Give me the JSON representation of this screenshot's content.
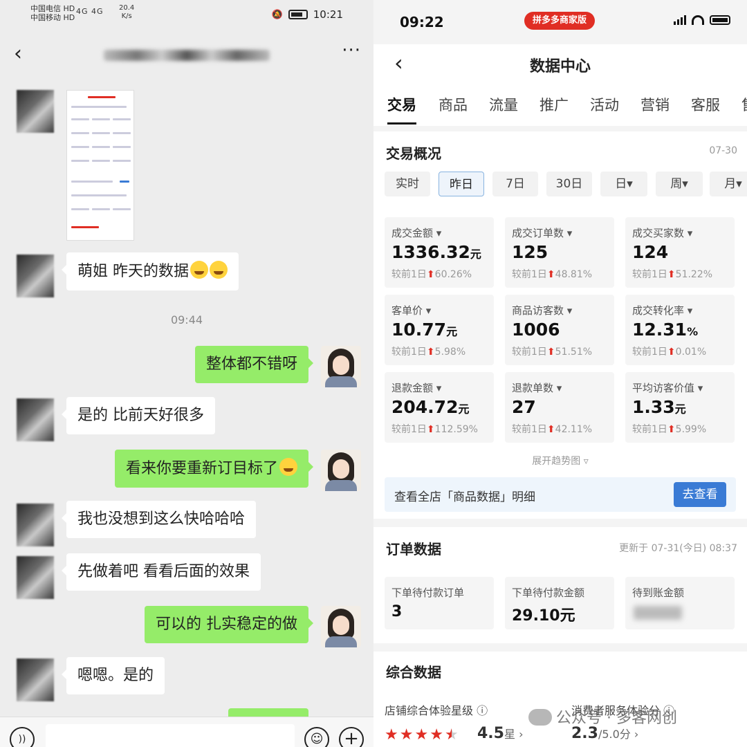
{
  "left": {
    "status": {
      "carrier1": "中国电信 HD",
      "carrier2": "中国移动 HD",
      "net": "4G 4G",
      "speed": "20.4",
      "speed_unit": "K/s",
      "time": "10:21"
    },
    "header": {
      "back_icon": "chevron-left-icon",
      "more_label": "···"
    },
    "timestamp": "09:44",
    "messages": [
      {
        "side": "in",
        "text": "萌姐 昨天的数据"
      },
      {
        "side": "out",
        "text": "整体都不错呀"
      },
      {
        "side": "in",
        "text": "是的 比前天好很多"
      },
      {
        "side": "out",
        "text": "看来你要重新订目标了"
      },
      {
        "side": "in",
        "text": "我也没想到这么快哈哈哈"
      },
      {
        "side": "in",
        "text": "先做着吧 看看后面的效果"
      },
      {
        "side": "out",
        "text": "可以的 扎实稳定的做"
      },
      {
        "side": "in",
        "text": "嗯嗯。是的"
      }
    ],
    "inputbar": {
      "voice": "))",
      "emoji": "☺",
      "plus": "+"
    }
  },
  "right": {
    "status": {
      "time": "09:22",
      "badge": "拼多多商家版"
    },
    "header": {
      "title": "数据中心",
      "back": "‹"
    },
    "tabs": [
      "交易",
      "商品",
      "流量",
      "推广",
      "活动",
      "营销",
      "客服",
      "售"
    ],
    "trade": {
      "title": "交易概况",
      "date": "07-30",
      "periods": [
        "实时",
        "昨日",
        "7日",
        "30日",
        "日▾",
        "周▾",
        "月▾"
      ],
      "metrics": [
        {
          "label": "成交金额 ▾",
          "value": "1336.32",
          "unit": "元",
          "cmp_prefix": "较前1日",
          "change": "60.26%"
        },
        {
          "label": "成交订单数 ▾",
          "value": "125",
          "unit": "",
          "cmp_prefix": "较前1日",
          "change": "48.81%"
        },
        {
          "label": "成交买家数 ▾",
          "value": "124",
          "unit": "",
          "cmp_prefix": "较前1日",
          "change": "51.22%"
        },
        {
          "label": "客单价 ▾",
          "value": "10.77",
          "unit": "元",
          "cmp_prefix": "较前1日",
          "change": "5.98%"
        },
        {
          "label": "商品访客数 ▾",
          "value": "1006",
          "unit": "",
          "cmp_prefix": "较前1日",
          "change": "51.51%"
        },
        {
          "label": "成交转化率 ▾",
          "value": "12.31",
          "unit": "%",
          "cmp_prefix": "较前1日",
          "change": "0.01%"
        },
        {
          "label": "退款金额 ▾",
          "value": "204.72",
          "unit": "元",
          "cmp_prefix": "较前1日",
          "change": "112.59%"
        },
        {
          "label": "退款单数 ▾",
          "value": "27",
          "unit": "",
          "cmp_prefix": "较前1日",
          "change": "42.11%"
        },
        {
          "label": "平均访客价值 ▾",
          "value": "1.33",
          "unit": "元",
          "cmp_prefix": "较前1日",
          "change": "5.99%"
        }
      ],
      "expand": "展开趋势图 ▿",
      "banner_text": "查看全店「商品数据」明细",
      "banner_btn": "去查看"
    },
    "orders": {
      "title": "订单数据",
      "updated": "更新于 07-31(今日) 08:37",
      "items": [
        {
          "label": "下单待付款订单",
          "value": "3"
        },
        {
          "label": "下单待付款金额",
          "value": "29.10元"
        },
        {
          "label": "待到账金额",
          "value": ""
        }
      ]
    },
    "overall": {
      "title": "综合数据",
      "exp_label": "店铺综合体验星级 ⓘ",
      "service_label": "消费者服务体验分 ⓘ",
      "stars": 4.5,
      "rating_value": "4.5",
      "rating_unit": "星 ›",
      "score_value": "2.3",
      "score_unit": "/5.0分 ›"
    }
  },
  "watermark": "公众号 · 多客网创"
}
